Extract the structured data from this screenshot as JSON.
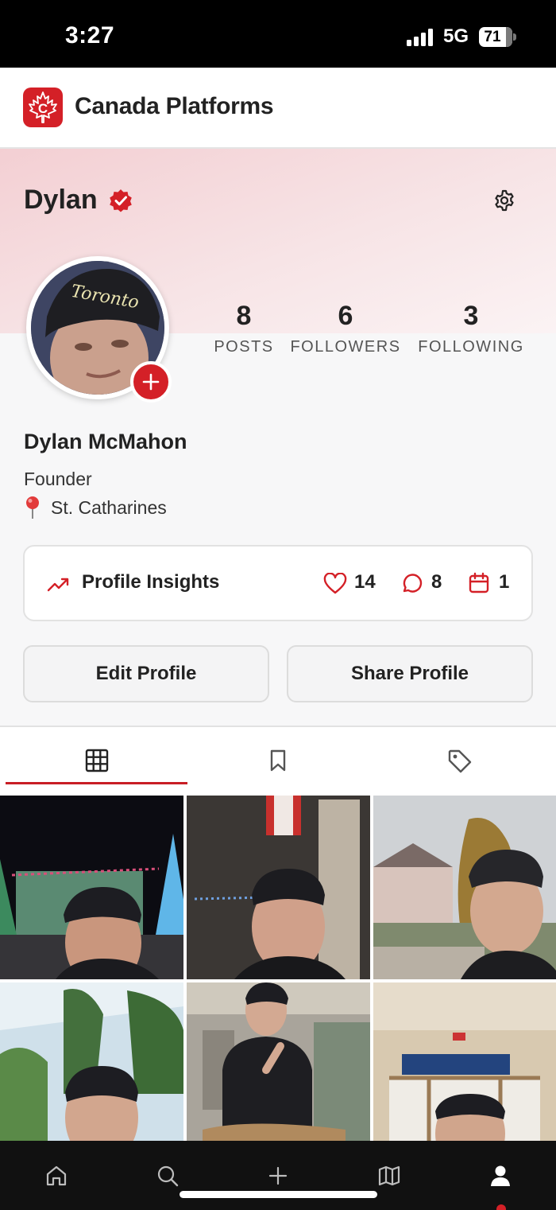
{
  "status_bar": {
    "time": "3:27",
    "network": "5G",
    "battery": "71"
  },
  "header": {
    "app_title": "Canada Platforms"
  },
  "profile": {
    "username": "Dylan",
    "full_name": "Dylan McMahon",
    "bio": "Founder",
    "location": "St. Catharines",
    "verified": true
  },
  "stats": [
    {
      "value": "8",
      "label": "POSTS"
    },
    {
      "value": "6",
      "label": "FOLLOWERS"
    },
    {
      "value": "3",
      "label": "FOLLOWING"
    }
  ],
  "insights": {
    "title": "Profile Insights",
    "likes": "14",
    "comments": "8",
    "events": "1"
  },
  "actions": {
    "edit": "Edit Profile",
    "share": "Share Profile"
  },
  "tabs": [
    {
      "icon": "grid-icon",
      "active": true
    },
    {
      "icon": "bookmark-icon",
      "active": false
    },
    {
      "icon": "tag-icon",
      "active": false
    }
  ],
  "bottom_nav": [
    "home-icon",
    "search-icon",
    "plus-icon",
    "map-icon",
    "profile-icon"
  ],
  "colors": {
    "brand": "#d42027",
    "accent_underline": "#c81e25",
    "banner": "#f3cfd3",
    "nav_bg": "#111111"
  }
}
